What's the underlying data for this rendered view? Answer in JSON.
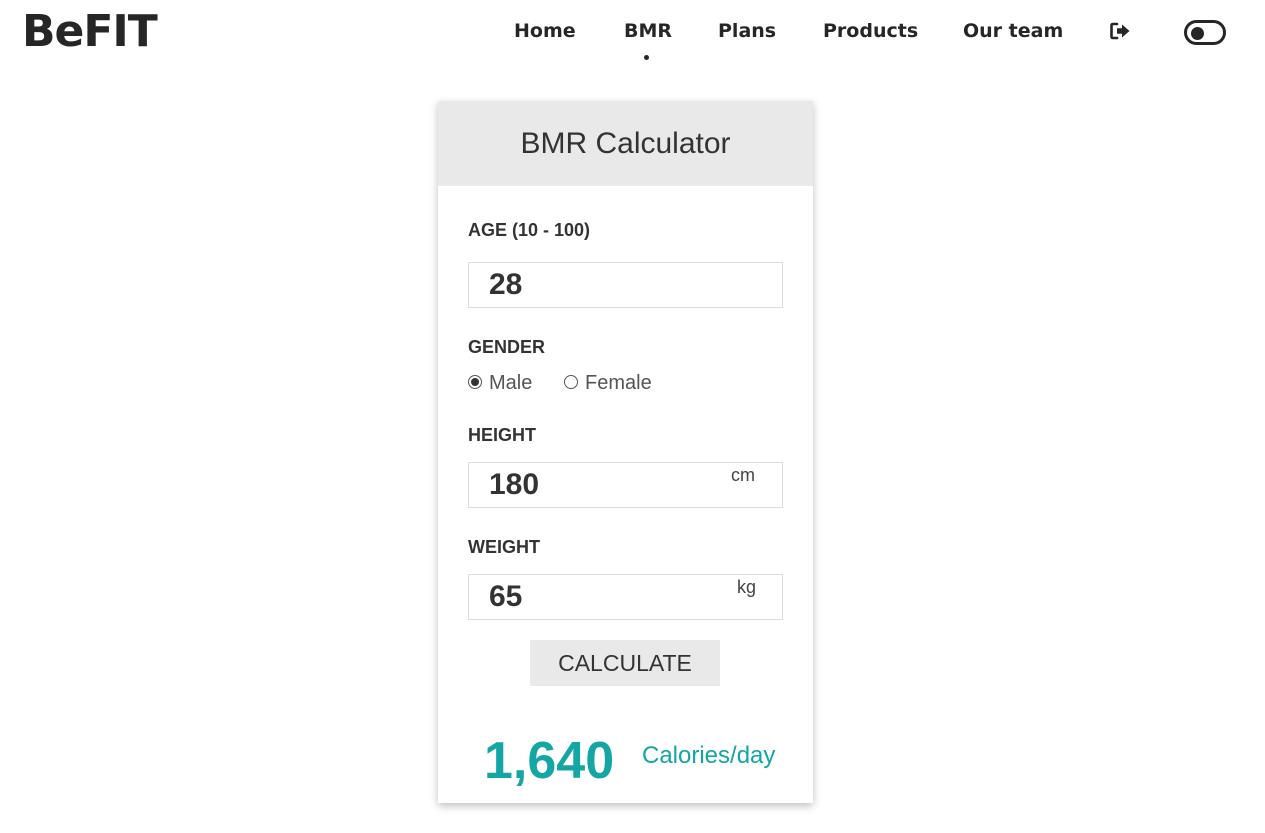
{
  "brand": {
    "logo": "BeFIT"
  },
  "nav": {
    "items": [
      {
        "label": "Home",
        "active": false
      },
      {
        "label": "BMR",
        "active": true
      },
      {
        "label": "Plans",
        "active": false
      },
      {
        "label": "Products",
        "active": false
      },
      {
        "label": "Our team",
        "active": false
      }
    ],
    "icons": [
      "logout-icon",
      "theme-toggle-icon"
    ]
  },
  "calculator": {
    "title": "BMR Calculator",
    "age": {
      "label": "AGE (10 - 100)",
      "value": "28"
    },
    "gender": {
      "label": "GENDER",
      "options": [
        "Male",
        "Female"
      ],
      "selected": "Male"
    },
    "height": {
      "label": "HEIGHT",
      "value": "180",
      "unit": "cm"
    },
    "weight": {
      "label": "WEIGHT",
      "value": "65",
      "unit": "kg"
    },
    "button_label": "CALCULATE",
    "result": {
      "value": "1,640",
      "unit": "Calories/day"
    }
  },
  "colors": {
    "accent": "#13a6a4",
    "text": "#262626",
    "header_bg": "#e9e9e9"
  }
}
